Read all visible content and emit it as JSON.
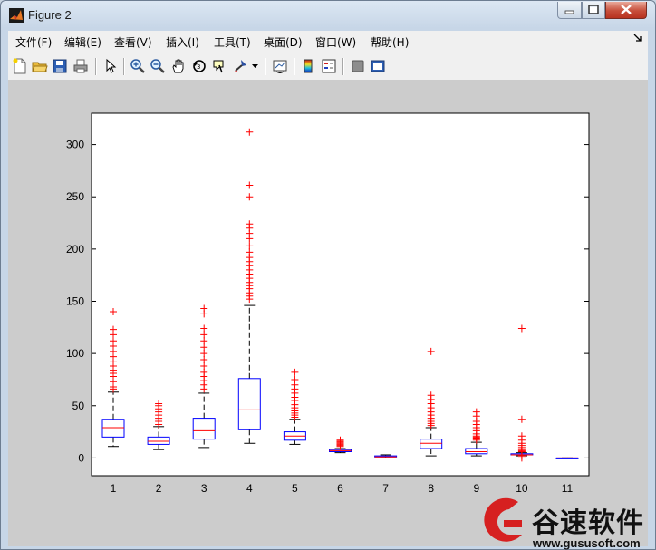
{
  "window": {
    "title": "Figure 2"
  },
  "menu": [
    "文件(F)",
    "编辑(E)",
    "查看(V)",
    "插入(I)",
    "工具(T)",
    "桌面(D)",
    "窗口(W)",
    "帮助(H)"
  ],
  "toolbar": {
    "icons": [
      "new-figure-icon",
      "open-file-icon",
      "save-icon",
      "print-icon",
      "edit-plot-arrow-icon",
      "zoom-in-icon",
      "zoom-out-icon",
      "pan-hand-icon",
      "rotate-3d-icon",
      "data-cursor-icon",
      "brush-icon",
      "link-plot-icon",
      "colorbar-icon",
      "legend-icon",
      "hide-plot-tools-icon",
      "show-plot-tools-icon"
    ]
  },
  "watermark": {
    "text": "谷速软件",
    "url": "www.gususoft.com"
  },
  "colors": {
    "box": "#0000ff",
    "median": "#ff0000",
    "whisker": "#000000",
    "outlier": "#ff0000"
  },
  "chart_data": {
    "type": "boxplot",
    "categories": [
      "1",
      "2",
      "3",
      "4",
      "5",
      "6",
      "7",
      "8",
      "9",
      "10",
      "11"
    ],
    "ylim": [
      -17,
      330
    ],
    "yticks": [
      0,
      50,
      100,
      150,
      200,
      250,
      300
    ],
    "grid": false,
    "boxes": [
      {
        "label": "1",
        "lower_whisker": 11,
        "q1": 20,
        "median": 29,
        "q3": 37,
        "upper_whisker": 63,
        "outliers": [
          66,
          68,
          73,
          78,
          81,
          84,
          88,
          92,
          97,
          102,
          107,
          112,
          118,
          123,
          140
        ]
      },
      {
        "label": "2",
        "lower_whisker": 8,
        "q1": 13,
        "median": 16,
        "q3": 20,
        "upper_whisker": 30,
        "outliers": [
          32,
          35,
          38,
          41,
          44,
          47,
          50,
          52
        ]
      },
      {
        "label": "3",
        "lower_whisker": 10,
        "q1": 18,
        "median": 26,
        "q3": 38,
        "upper_whisker": 62,
        "outliers": [
          66,
          70,
          74,
          78,
          82,
          88,
          94,
          100,
          106,
          112,
          118,
          124,
          138,
          143
        ]
      },
      {
        "label": "4",
        "lower_whisker": 14,
        "q1": 27,
        "median": 46,
        "q3": 76,
        "upper_whisker": 146,
        "outliers": [
          152,
          155,
          158,
          162,
          165,
          168,
          172,
          176,
          180,
          184,
          188,
          192,
          197,
          203,
          210,
          215,
          220,
          224,
          250,
          261,
          312
        ]
      },
      {
        "label": "5",
        "lower_whisker": 13,
        "q1": 17,
        "median": 21,
        "q3": 25,
        "upper_whisker": 37,
        "outliers": [
          39,
          41,
          43,
          45,
          48,
          51,
          55,
          58,
          62,
          66,
          70,
          75,
          82
        ]
      },
      {
        "label": "6",
        "lower_whisker": 5,
        "q1": 6,
        "median": 7,
        "q3": 8,
        "upper_whisker": 9,
        "outliers": [
          11,
          12,
          13,
          14,
          15,
          16,
          17
        ]
      },
      {
        "label": "7",
        "lower_whisker": 0,
        "q1": 1,
        "median": 1,
        "q3": 2,
        "upper_whisker": 3,
        "outliers": []
      },
      {
        "label": "8",
        "lower_whisker": 2,
        "q1": 9,
        "median": 14,
        "q3": 18,
        "upper_whisker": 29,
        "outliers": [
          31,
          33,
          35,
          38,
          41,
          44,
          48,
          52,
          56,
          60,
          102
        ]
      },
      {
        "label": "9",
        "lower_whisker": 2,
        "q1": 4,
        "median": 6,
        "q3": 9,
        "upper_whisker": 15,
        "outliers": [
          17,
          19,
          20,
          21,
          23,
          26,
          29,
          32,
          35,
          40,
          44
        ]
      },
      {
        "label": "10",
        "lower_whisker": 2,
        "q1": 3,
        "median": 3,
        "q3": 4,
        "upper_whisker": 5,
        "outliers": [
          0,
          2,
          6,
          7,
          8,
          10,
          12,
          14,
          17,
          21,
          37,
          124
        ]
      },
      {
        "label": "11",
        "lower_whisker": 0,
        "q1": 0,
        "median": 0,
        "q3": 0,
        "upper_whisker": 0,
        "outliers": []
      }
    ]
  }
}
